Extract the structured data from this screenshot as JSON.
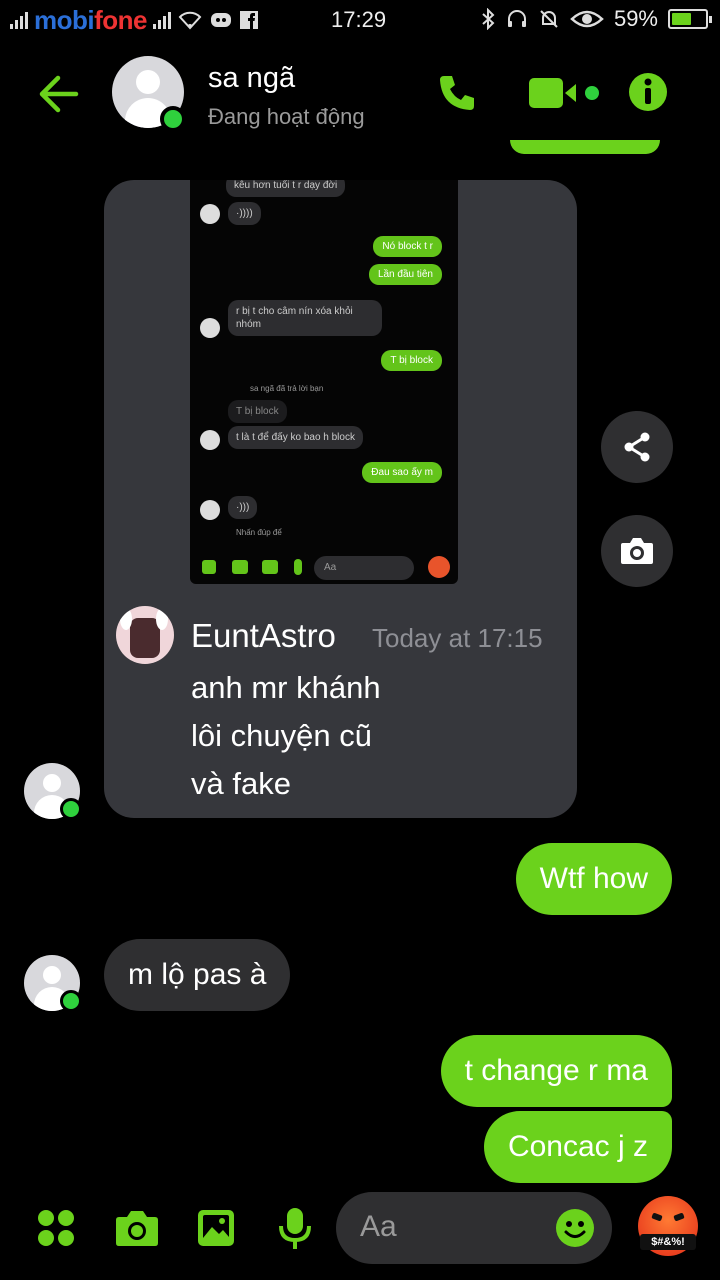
{
  "status_bar": {
    "carrier_a": "mobi",
    "carrier_b": "fone",
    "time": "17:29",
    "battery": "59%",
    "battery_level": 0.59
  },
  "header": {
    "name": "sa ngã",
    "status": "Đang hoạt động",
    "accent": "#6bd21c"
  },
  "shared_image": {
    "phone_messages": {
      "m1": "kêu hơn tuổi t r dạy đời",
      "voice1": "·))))",
      "out1": "Nó block t r",
      "out2": "Lần đầu tiên",
      "m2": "r bị t cho câm nín xóa khỏi nhóm",
      "out3": "T bị block",
      "reply_note": "sa ngã đã trả lời bạn",
      "quote": "T bị block",
      "m3": "t là t để đấy ko bao h block",
      "out4": "Đau sao ấy m",
      "voice2": "·)))",
      "reaction_note": "Nhấn đúp để",
      "input_placeholder": "Aa"
    },
    "discord": {
      "username": "EuntAstro",
      "timestamp": "Today at 17:15",
      "lines": [
        "anh mr khánh",
        "lôi chuyện cũ",
        "và fake"
      ]
    }
  },
  "messages": [
    {
      "direction": "out",
      "text": "Wtf how"
    },
    {
      "direction": "in",
      "text": "m lộ pas à"
    },
    {
      "direction": "out",
      "text": "t change r ma"
    },
    {
      "direction": "out",
      "text": "Concac j z"
    }
  ],
  "composer": {
    "placeholder": "Aa",
    "quick_reaction_text": "$#&%!"
  }
}
